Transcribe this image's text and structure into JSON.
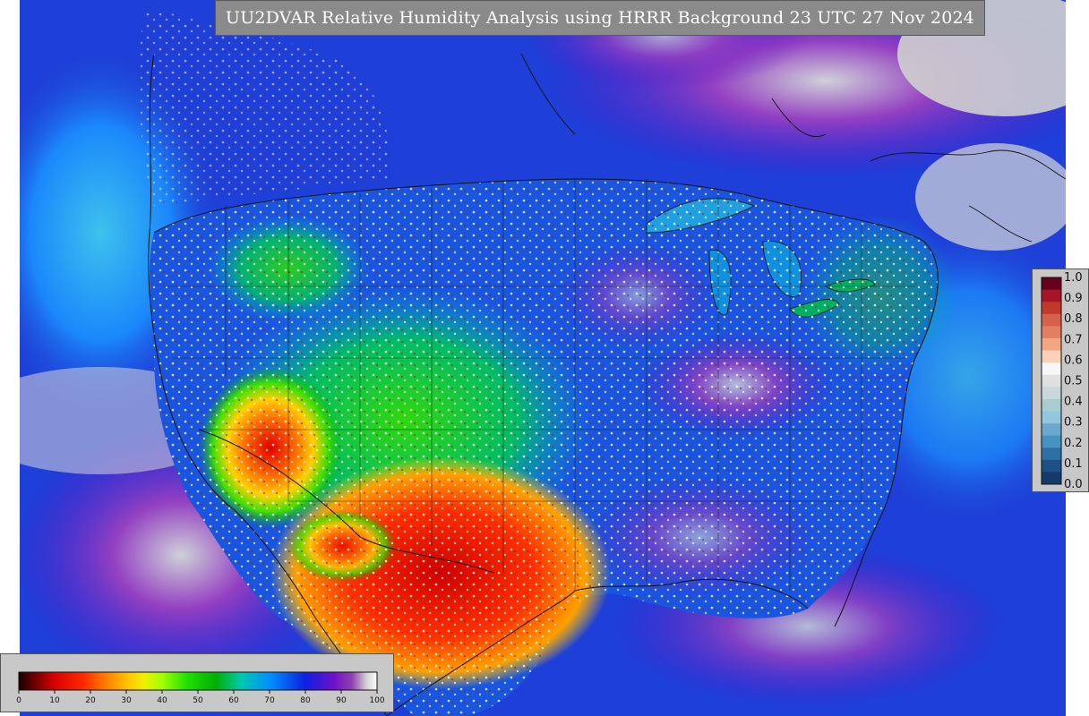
{
  "title": "UU2DVAR Relative Humidity Analysis using HRRR Background 23 UTC 27 Nov 2024",
  "rh_colorbar": {
    "ticks": [
      "0",
      "10",
      "20",
      "30",
      "40",
      "50",
      "60",
      "70",
      "80",
      "90",
      "100"
    ],
    "stops": [
      {
        "value": 0,
        "color": "#1a0000"
      },
      {
        "value": 5,
        "color": "#7a0000"
      },
      {
        "value": 10,
        "color": "#d80000"
      },
      {
        "value": 18,
        "color": "#ff2a00"
      },
      {
        "value": 24,
        "color": "#ff7a00"
      },
      {
        "value": 30,
        "color": "#ffc000"
      },
      {
        "value": 35,
        "color": "#f0f000"
      },
      {
        "value": 40,
        "color": "#a0ff00"
      },
      {
        "value": 47,
        "color": "#20e000"
      },
      {
        "value": 55,
        "color": "#00b000"
      },
      {
        "value": 62,
        "color": "#00c8b0"
      },
      {
        "value": 70,
        "color": "#0090ff"
      },
      {
        "value": 80,
        "color": "#1020e0"
      },
      {
        "value": 88,
        "color": "#7010c8"
      },
      {
        "value": 93,
        "color": "#9040b0"
      },
      {
        "value": 97,
        "color": "#d0d0d0"
      },
      {
        "value": 100,
        "color": "#ffffff"
      }
    ]
  },
  "bias_colorbar": {
    "ticks": [
      "1.0",
      "0.9",
      "0.8",
      "0.7",
      "0.6",
      "0.5",
      "0.4",
      "0.3",
      "0.2",
      "0.1",
      "0.0"
    ],
    "colors": [
      "#67001f",
      "#a51427",
      "#c0392b",
      "#d6604d",
      "#e08060",
      "#f4a582",
      "#fbd0b8",
      "#f7f7f7",
      "#e0e0e0",
      "#c8d8dc",
      "#a8ccd0",
      "#92c5de",
      "#6aa8d0",
      "#4393c3",
      "#2f6fa8",
      "#1f4f88",
      "#153a6a"
    ]
  }
}
